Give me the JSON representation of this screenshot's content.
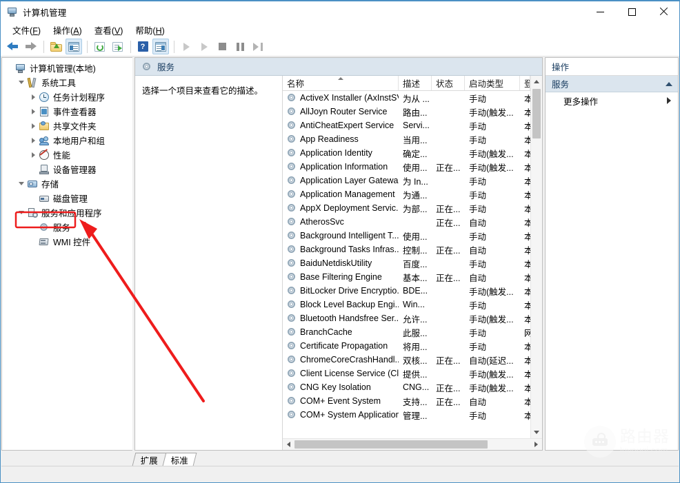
{
  "window": {
    "title": "计算机管理",
    "icon": "computer-management-icon",
    "controls": {
      "minimize": "最小化",
      "maximize": "最大化",
      "close": "关闭"
    }
  },
  "menubar": [
    {
      "label": "文件",
      "accel": "F"
    },
    {
      "label": "操作",
      "accel": "A"
    },
    {
      "label": "查看",
      "accel": "V"
    },
    {
      "label": "帮助",
      "accel": "H"
    }
  ],
  "toolbar": [
    {
      "name": "back-arrow-icon",
      "enabled": true
    },
    {
      "name": "forward-arrow-icon",
      "enabled": false
    },
    {
      "name": "separator"
    },
    {
      "name": "folder-up-icon",
      "enabled": true
    },
    {
      "name": "show-hide-tree-icon",
      "enabled": true,
      "framed": true
    },
    {
      "name": "separator"
    },
    {
      "name": "refresh-icon",
      "enabled": true
    },
    {
      "name": "export-list-icon",
      "enabled": true
    },
    {
      "name": "separator"
    },
    {
      "name": "help-icon",
      "enabled": true
    },
    {
      "name": "show-action-pane-icon",
      "enabled": true,
      "framed": true
    },
    {
      "name": "separator"
    },
    {
      "name": "start-service-icon",
      "enabled": false
    },
    {
      "name": "start-all-icon",
      "enabled": false
    },
    {
      "name": "stop-service-icon",
      "enabled": false
    },
    {
      "name": "pause-service-icon",
      "enabled": false
    },
    {
      "name": "restart-service-icon",
      "enabled": false
    }
  ],
  "tree": {
    "root": {
      "label": "计算机管理(本地)",
      "icon": "computer-icon",
      "indent": 0,
      "twisty": "none"
    },
    "items": [
      {
        "label": "系统工具",
        "icon": "system-tools-icon",
        "indent": 1,
        "twisty": "open"
      },
      {
        "label": "任务计划程序",
        "icon": "task-scheduler-icon",
        "indent": 2,
        "twisty": "closed"
      },
      {
        "label": "事件查看器",
        "icon": "event-viewer-icon",
        "indent": 2,
        "twisty": "closed"
      },
      {
        "label": "共享文件夹",
        "icon": "shared-folders-icon",
        "indent": 2,
        "twisty": "closed"
      },
      {
        "label": "本地用户和组",
        "icon": "local-users-groups-icon",
        "indent": 2,
        "twisty": "closed"
      },
      {
        "label": "性能",
        "icon": "performance-icon",
        "indent": 2,
        "twisty": "closed"
      },
      {
        "label": "设备管理器",
        "icon": "device-manager-icon",
        "indent": 2,
        "twisty": "none"
      },
      {
        "label": "存储",
        "icon": "storage-icon",
        "indent": 1,
        "twisty": "open"
      },
      {
        "label": "磁盘管理",
        "icon": "disk-management-icon",
        "indent": 2,
        "twisty": "none"
      },
      {
        "label": "服务和应用程序",
        "icon": "services-applications-icon",
        "indent": 1,
        "twisty": "open"
      },
      {
        "label": "服务",
        "icon": "services-icon",
        "indent": 2,
        "twisty": "none",
        "selected": true,
        "highlighted": true
      },
      {
        "label": "WMI 控件",
        "icon": "wmi-control-icon",
        "indent": 2,
        "twisty": "none"
      }
    ]
  },
  "main": {
    "header": {
      "title": "服务",
      "icon": "services-gear-icon"
    },
    "description": "选择一个项目来查看它的描述。",
    "columns": [
      {
        "key": "name",
        "label": "名称",
        "sorted": "asc"
      },
      {
        "key": "desc",
        "label": "描述"
      },
      {
        "key": "status",
        "label": "状态"
      },
      {
        "key": "start",
        "label": "启动类型"
      },
      {
        "key": "logon",
        "label": "登"
      }
    ],
    "rows": [
      {
        "name": "ActiveX Installer (AxInstSV)",
        "desc": "为从 ...",
        "status": "",
        "start": "手动",
        "logon": "本"
      },
      {
        "name": "AllJoyn Router Service",
        "desc": "路由...",
        "status": "",
        "start": "手动(触发...",
        "logon": "本"
      },
      {
        "name": "AntiCheatExpert Service",
        "desc": "Servi...",
        "status": "",
        "start": "手动",
        "logon": "本"
      },
      {
        "name": "App Readiness",
        "desc": "当用...",
        "status": "",
        "start": "手动",
        "logon": "本"
      },
      {
        "name": "Application Identity",
        "desc": "确定...",
        "status": "",
        "start": "手动(触发...",
        "logon": "本"
      },
      {
        "name": "Application Information",
        "desc": "使用...",
        "status": "正在...",
        "start": "手动(触发...",
        "logon": "本"
      },
      {
        "name": "Application Layer Gatewa...",
        "desc": "为 In...",
        "status": "",
        "start": "手动",
        "logon": "本"
      },
      {
        "name": "Application Management",
        "desc": "为通...",
        "status": "",
        "start": "手动",
        "logon": "本"
      },
      {
        "name": "AppX Deployment Servic...",
        "desc": "为部...",
        "status": "正在...",
        "start": "手动",
        "logon": "本"
      },
      {
        "name": "AtherosSvc",
        "desc": "",
        "status": "正在...",
        "start": "自动",
        "logon": "本"
      },
      {
        "name": "Background Intelligent T...",
        "desc": "使用...",
        "status": "",
        "start": "手动",
        "logon": "本"
      },
      {
        "name": "Background Tasks Infras...",
        "desc": "控制...",
        "status": "正在...",
        "start": "自动",
        "logon": "本"
      },
      {
        "name": "BaiduNetdiskUtility",
        "desc": "百度...",
        "status": "",
        "start": "手动",
        "logon": "本"
      },
      {
        "name": "Base Filtering Engine",
        "desc": "基本...",
        "status": "正在...",
        "start": "自动",
        "logon": "本"
      },
      {
        "name": "BitLocker Drive Encryptio...",
        "desc": "BDE...",
        "status": "",
        "start": "手动(触发...",
        "logon": "本"
      },
      {
        "name": "Block Level Backup Engi...",
        "desc": "Win...",
        "status": "",
        "start": "手动",
        "logon": "本"
      },
      {
        "name": "Bluetooth Handsfree Ser...",
        "desc": "允许...",
        "status": "",
        "start": "手动(触发...",
        "logon": "本"
      },
      {
        "name": "BranchCache",
        "desc": "此服...",
        "status": "",
        "start": "手动",
        "logon": "网"
      },
      {
        "name": "Certificate Propagation",
        "desc": "将用...",
        "status": "",
        "start": "手动",
        "logon": "本"
      },
      {
        "name": "ChromeCoreCrashHandl...",
        "desc": "双核...",
        "status": "正在...",
        "start": "自动(延迟...",
        "logon": "本"
      },
      {
        "name": "Client License Service (Cli...",
        "desc": "提供...",
        "status": "",
        "start": "手动(触发...",
        "logon": "本"
      },
      {
        "name": "CNG Key Isolation",
        "desc": "CNG...",
        "status": "正在...",
        "start": "手动(触发...",
        "logon": "本"
      },
      {
        "name": "COM+ Event System",
        "desc": "支持...",
        "status": "正在...",
        "start": "自动",
        "logon": "本"
      },
      {
        "name": "COM+ System Application",
        "desc": "管理...",
        "status": "",
        "start": "手动",
        "logon": "本"
      }
    ],
    "tabs": [
      {
        "label": "扩展",
        "active": false
      },
      {
        "label": "标准",
        "active": true
      }
    ]
  },
  "actions": {
    "header": "操作",
    "group": {
      "label": "服务",
      "collapse_icon": "collapse-chevron-up-icon"
    },
    "items": [
      {
        "label": "更多操作",
        "submenu_icon": "submenu-arrow-icon"
      }
    ]
  },
  "annotation": {
    "color": "#ee1c1c",
    "highlight_target": "服务",
    "arrow": "red-arrow-pointing-to-services"
  },
  "watermark": {
    "cn": "路由器",
    "en": "luyouqi.com",
    "icon": "router-icon"
  }
}
